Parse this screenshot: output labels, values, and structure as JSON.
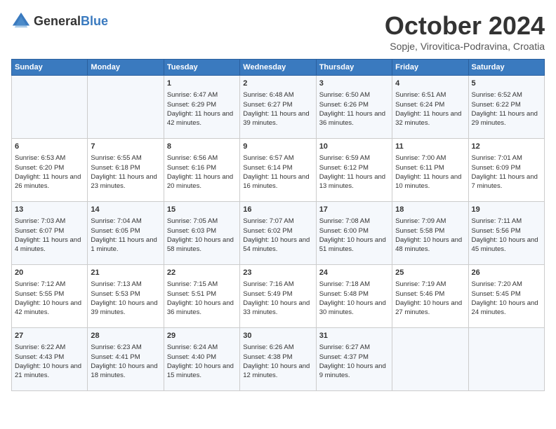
{
  "header": {
    "logo_general": "General",
    "logo_blue": "Blue",
    "month_title": "October 2024",
    "location": "Sopje, Virovitica-Podravina, Croatia"
  },
  "days_of_week": [
    "Sunday",
    "Monday",
    "Tuesday",
    "Wednesday",
    "Thursday",
    "Friday",
    "Saturday"
  ],
  "weeks": [
    [
      {
        "day": "",
        "content": ""
      },
      {
        "day": "",
        "content": ""
      },
      {
        "day": "1",
        "content": "Sunrise: 6:47 AM\nSunset: 6:29 PM\nDaylight: 11 hours and 42 minutes."
      },
      {
        "day": "2",
        "content": "Sunrise: 6:48 AM\nSunset: 6:27 PM\nDaylight: 11 hours and 39 minutes."
      },
      {
        "day": "3",
        "content": "Sunrise: 6:50 AM\nSunset: 6:26 PM\nDaylight: 11 hours and 36 minutes."
      },
      {
        "day": "4",
        "content": "Sunrise: 6:51 AM\nSunset: 6:24 PM\nDaylight: 11 hours and 32 minutes."
      },
      {
        "day": "5",
        "content": "Sunrise: 6:52 AM\nSunset: 6:22 PM\nDaylight: 11 hours and 29 minutes."
      }
    ],
    [
      {
        "day": "6",
        "content": "Sunrise: 6:53 AM\nSunset: 6:20 PM\nDaylight: 11 hours and 26 minutes."
      },
      {
        "day": "7",
        "content": "Sunrise: 6:55 AM\nSunset: 6:18 PM\nDaylight: 11 hours and 23 minutes."
      },
      {
        "day": "8",
        "content": "Sunrise: 6:56 AM\nSunset: 6:16 PM\nDaylight: 11 hours and 20 minutes."
      },
      {
        "day": "9",
        "content": "Sunrise: 6:57 AM\nSunset: 6:14 PM\nDaylight: 11 hours and 16 minutes."
      },
      {
        "day": "10",
        "content": "Sunrise: 6:59 AM\nSunset: 6:12 PM\nDaylight: 11 hours and 13 minutes."
      },
      {
        "day": "11",
        "content": "Sunrise: 7:00 AM\nSunset: 6:11 PM\nDaylight: 11 hours and 10 minutes."
      },
      {
        "day": "12",
        "content": "Sunrise: 7:01 AM\nSunset: 6:09 PM\nDaylight: 11 hours and 7 minutes."
      }
    ],
    [
      {
        "day": "13",
        "content": "Sunrise: 7:03 AM\nSunset: 6:07 PM\nDaylight: 11 hours and 4 minutes."
      },
      {
        "day": "14",
        "content": "Sunrise: 7:04 AM\nSunset: 6:05 PM\nDaylight: 11 hours and 1 minute."
      },
      {
        "day": "15",
        "content": "Sunrise: 7:05 AM\nSunset: 6:03 PM\nDaylight: 10 hours and 58 minutes."
      },
      {
        "day": "16",
        "content": "Sunrise: 7:07 AM\nSunset: 6:02 PM\nDaylight: 10 hours and 54 minutes."
      },
      {
        "day": "17",
        "content": "Sunrise: 7:08 AM\nSunset: 6:00 PM\nDaylight: 10 hours and 51 minutes."
      },
      {
        "day": "18",
        "content": "Sunrise: 7:09 AM\nSunset: 5:58 PM\nDaylight: 10 hours and 48 minutes."
      },
      {
        "day": "19",
        "content": "Sunrise: 7:11 AM\nSunset: 5:56 PM\nDaylight: 10 hours and 45 minutes."
      }
    ],
    [
      {
        "day": "20",
        "content": "Sunrise: 7:12 AM\nSunset: 5:55 PM\nDaylight: 10 hours and 42 minutes."
      },
      {
        "day": "21",
        "content": "Sunrise: 7:13 AM\nSunset: 5:53 PM\nDaylight: 10 hours and 39 minutes."
      },
      {
        "day": "22",
        "content": "Sunrise: 7:15 AM\nSunset: 5:51 PM\nDaylight: 10 hours and 36 minutes."
      },
      {
        "day": "23",
        "content": "Sunrise: 7:16 AM\nSunset: 5:49 PM\nDaylight: 10 hours and 33 minutes."
      },
      {
        "day": "24",
        "content": "Sunrise: 7:18 AM\nSunset: 5:48 PM\nDaylight: 10 hours and 30 minutes."
      },
      {
        "day": "25",
        "content": "Sunrise: 7:19 AM\nSunset: 5:46 PM\nDaylight: 10 hours and 27 minutes."
      },
      {
        "day": "26",
        "content": "Sunrise: 7:20 AM\nSunset: 5:45 PM\nDaylight: 10 hours and 24 minutes."
      }
    ],
    [
      {
        "day": "27",
        "content": "Sunrise: 6:22 AM\nSunset: 4:43 PM\nDaylight: 10 hours and 21 minutes."
      },
      {
        "day": "28",
        "content": "Sunrise: 6:23 AM\nSunset: 4:41 PM\nDaylight: 10 hours and 18 minutes."
      },
      {
        "day": "29",
        "content": "Sunrise: 6:24 AM\nSunset: 4:40 PM\nDaylight: 10 hours and 15 minutes."
      },
      {
        "day": "30",
        "content": "Sunrise: 6:26 AM\nSunset: 4:38 PM\nDaylight: 10 hours and 12 minutes."
      },
      {
        "day": "31",
        "content": "Sunrise: 6:27 AM\nSunset: 4:37 PM\nDaylight: 10 hours and 9 minutes."
      },
      {
        "day": "",
        "content": ""
      },
      {
        "day": "",
        "content": ""
      }
    ]
  ]
}
